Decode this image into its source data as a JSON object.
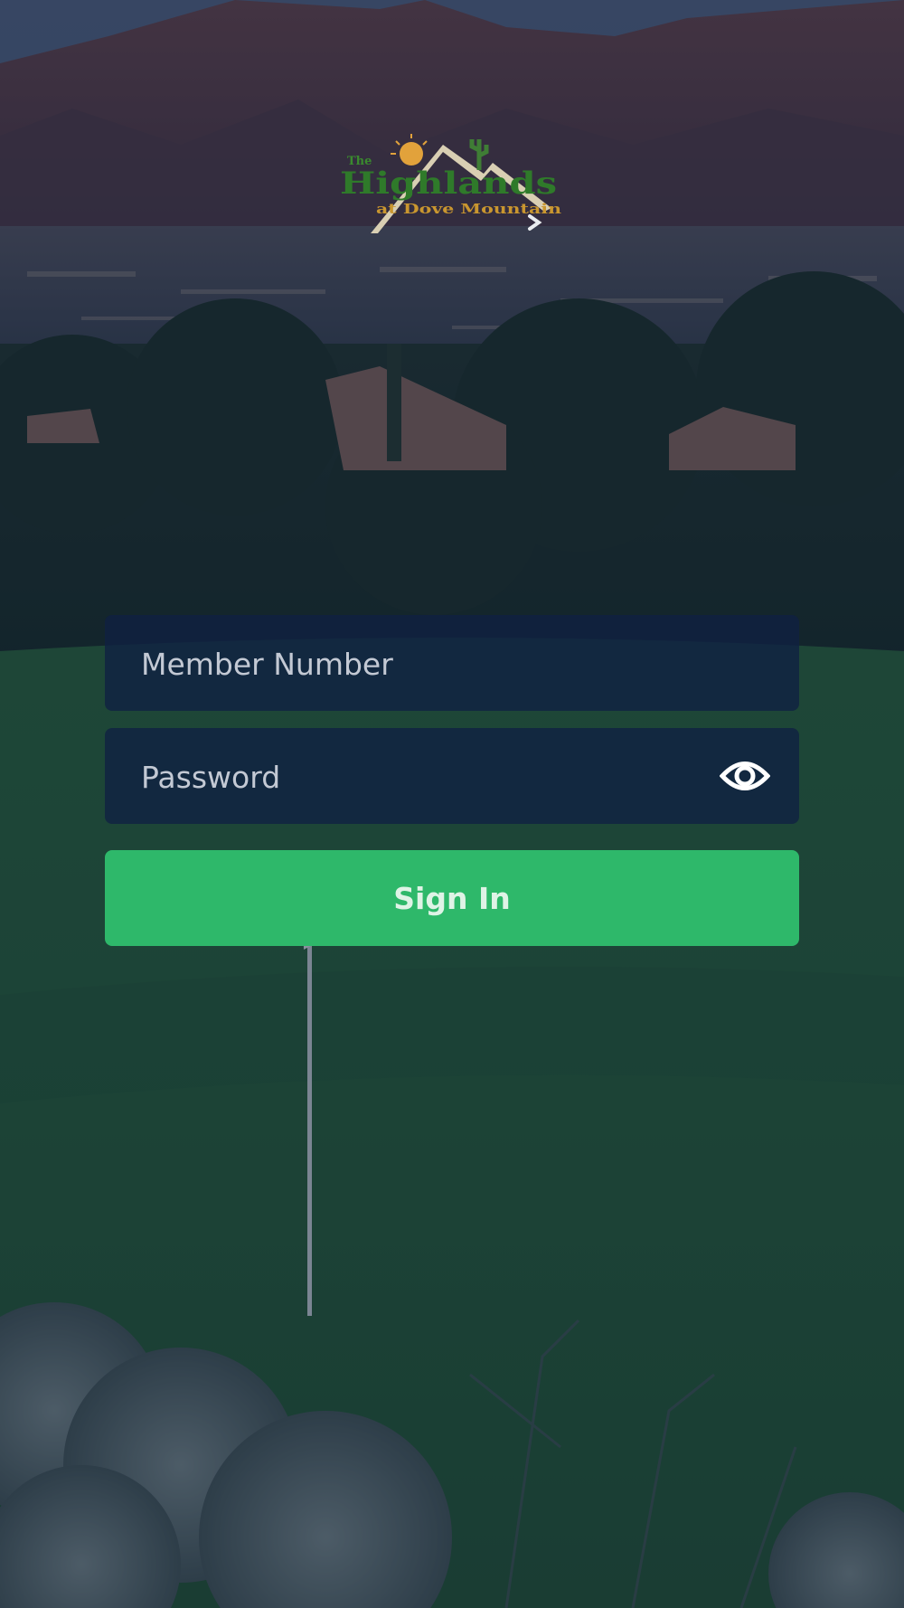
{
  "brand": {
    "logo_line1": "The",
    "logo_line2": "Highlands",
    "logo_line3": "at Dove Mountain"
  },
  "login": {
    "member_placeholder": "Member Number",
    "member_value": "",
    "password_placeholder": "Password",
    "password_value": "",
    "signin_label": "Sign In"
  },
  "colors": {
    "signin_button": "#2eb86a",
    "logo_green": "#2f7a2a",
    "logo_gold": "#c9962f"
  },
  "icons": {
    "password_toggle": "eye-icon",
    "logo_chevron": "chevron-right-icon"
  }
}
